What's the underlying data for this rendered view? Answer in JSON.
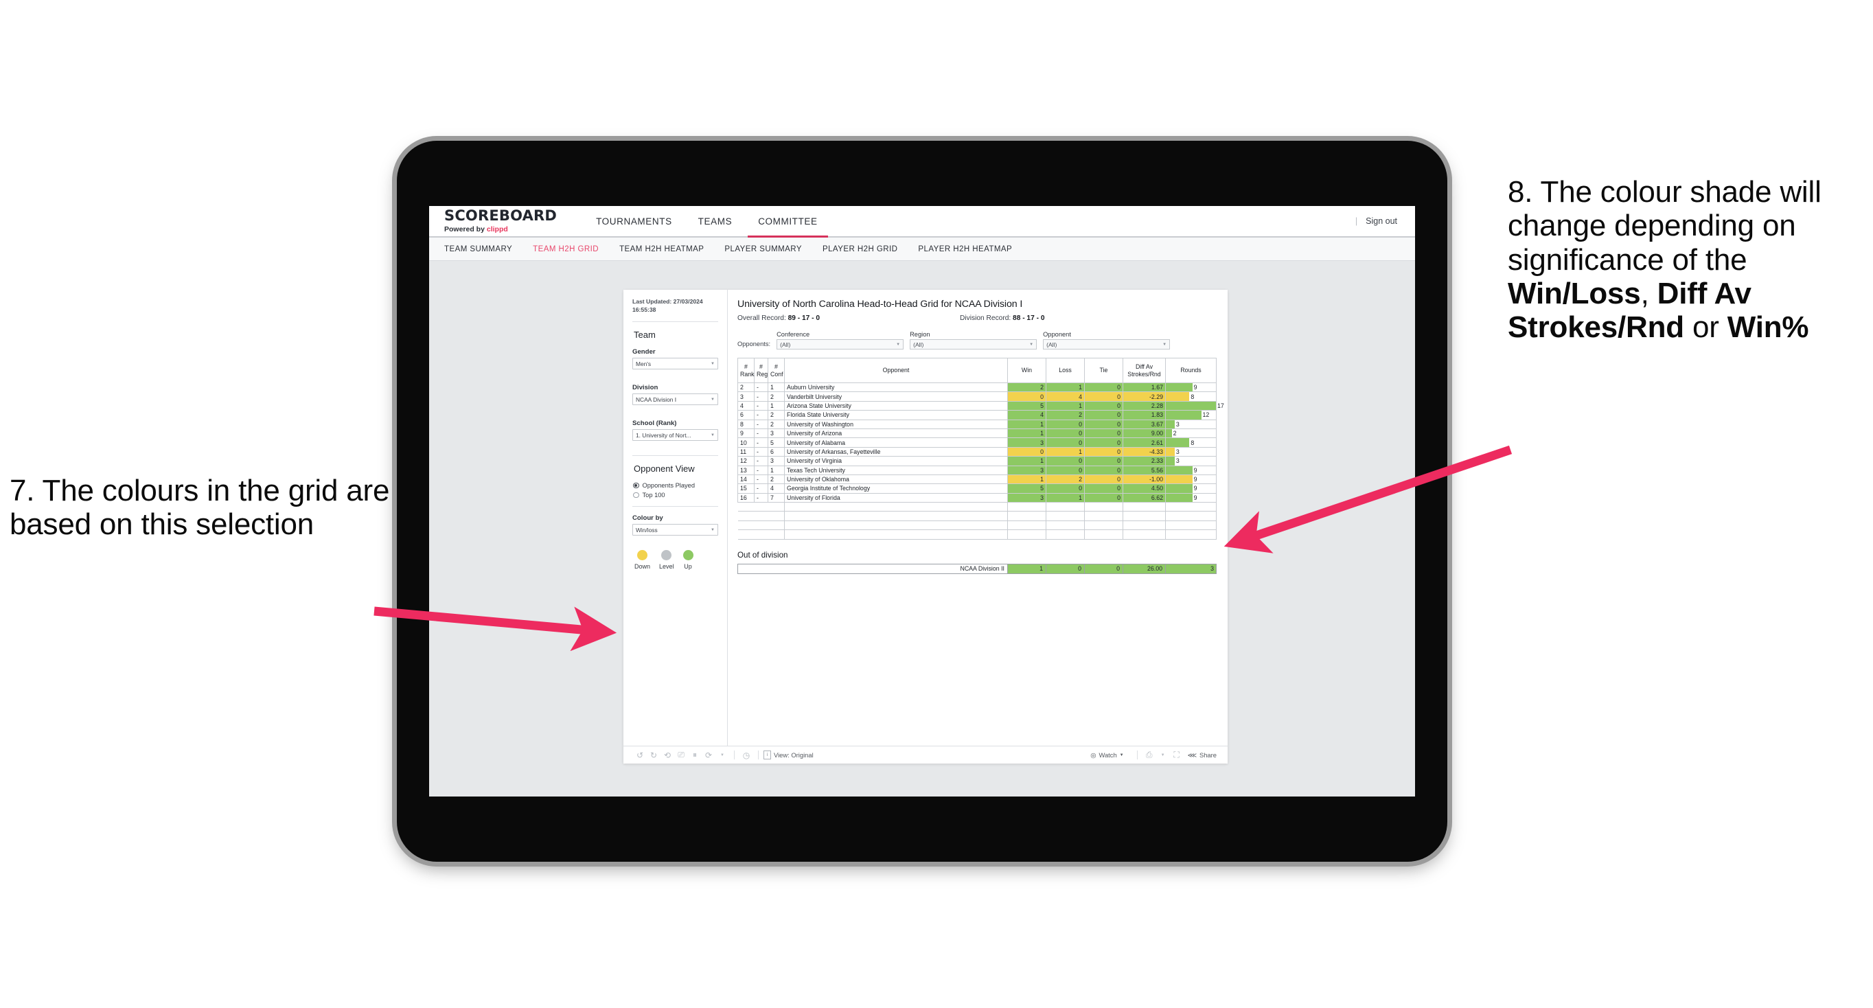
{
  "annotations": {
    "left": "7. The colours in the grid are based on this selection",
    "right_plain_1": "8. The colour shade will change depending on significance of the ",
    "right_bold_1": "Win/Loss",
    "right_plain_2": ", ",
    "right_bold_2": "Diff Av Strokes/Rnd",
    "right_plain_3": " or ",
    "right_bold_3": "Win%",
    "arrow_color": "#ED2B5F"
  },
  "app": {
    "brand_title": "SCOREBOARD",
    "brand_sub_prefix": "Powered by ",
    "brand_sub_accent": "clippd",
    "nav": [
      {
        "label": "TOURNAMENTS",
        "active": false
      },
      {
        "label": "TEAMS",
        "active": false
      },
      {
        "label": "COMMITTEE",
        "active": true
      }
    ],
    "divider": "|",
    "sign_out": "Sign out",
    "subnav": [
      {
        "label": "TEAM SUMMARY",
        "active": false
      },
      {
        "label": "TEAM H2H GRID",
        "active": true
      },
      {
        "label": "TEAM H2H HEATMAP",
        "active": false
      },
      {
        "label": "PLAYER SUMMARY",
        "active": false
      },
      {
        "label": "PLAYER H2H GRID",
        "active": false
      },
      {
        "label": "PLAYER H2H HEATMAP",
        "active": false
      }
    ],
    "accent_color": "#E8486C"
  },
  "sidebar": {
    "last_updated": "Last Updated: 27/03/2024 16:55:38",
    "team_title": "Team",
    "gender_label": "Gender",
    "gender_value": "Men's",
    "division_label": "Division",
    "division_value": "NCAA Division I",
    "school_label": "School (Rank)",
    "school_value": "1. University of Nort...",
    "opponent_view_title": "Opponent View",
    "radio_opponents_played": "Opponents Played",
    "radio_top_100": "Top 100",
    "colour_by_label": "Colour by",
    "colour_by_value": "Win/loss",
    "legend": [
      {
        "label": "Down",
        "color": "#F2D24D"
      },
      {
        "label": "Level",
        "color": "#BFC3C7"
      },
      {
        "label": "Up",
        "color": "#8DC963"
      }
    ]
  },
  "main": {
    "title": "University of North Carolina Head-to-Head Grid for NCAA Division I",
    "overall_record_label": "Overall Record: ",
    "overall_record_value": "89 - 17 - 0",
    "division_record_label": "Division Record: ",
    "division_record_value": "88 - 17 - 0",
    "opponents_label": "Opponents:",
    "filters": [
      {
        "caption": "Conference",
        "value": "(All)"
      },
      {
        "caption": "Region",
        "value": "(All)"
      },
      {
        "caption": "Opponent",
        "value": "(All)"
      }
    ],
    "headers": [
      "# Rank",
      "# Reg",
      "# Conf",
      "Opponent",
      "Win",
      "Loss",
      "Tie",
      "Diff Av Strokes/Rnd",
      "Rounds"
    ],
    "out_of_division_title": "Out of division",
    "out_of_division_row": {
      "name": "NCAA Division II",
      "win": "1",
      "loss": "0",
      "tie": "0",
      "diff": "26.00",
      "rounds": "3",
      "color": "#8DC963",
      "bar_pct": 100
    }
  },
  "chart_data": {
    "type": "table",
    "title": "University of North Carolina Head-to-Head Grid for NCAA Division I",
    "columns": [
      "# Rank",
      "# Reg",
      "# Conf",
      "Opponent",
      "Win",
      "Loss",
      "Tie",
      "Diff Av Strokes/Rnd",
      "Rounds"
    ],
    "colour_by": "Win/loss",
    "colour_scale": {
      "Down": "#F2D24D",
      "Level": "#BFC3C7",
      "Up": "#8DC963"
    },
    "rounds_max": 17,
    "rows": [
      {
        "rank": "2",
        "reg": "-",
        "conf": "1",
        "opponent": "Auburn University",
        "win": "2",
        "loss": "1",
        "tie": "0",
        "diff": "1.67",
        "rounds": "9",
        "color": "#8DC963"
      },
      {
        "rank": "3",
        "reg": "-",
        "conf": "2",
        "opponent": "Vanderbilt University",
        "win": "0",
        "loss": "4",
        "tie": "0",
        "diff": "-2.29",
        "rounds": "8",
        "color": "#F2D24D"
      },
      {
        "rank": "4",
        "reg": "-",
        "conf": "1",
        "opponent": "Arizona State University",
        "win": "5",
        "loss": "1",
        "tie": "0",
        "diff": "2.28",
        "rounds": "17",
        "color": "#8DC963"
      },
      {
        "rank": "6",
        "reg": "-",
        "conf": "2",
        "opponent": "Florida State University",
        "win": "4",
        "loss": "2",
        "tie": "0",
        "diff": "1.83",
        "rounds": "12",
        "color": "#8DC963"
      },
      {
        "rank": "8",
        "reg": "-",
        "conf": "2",
        "opponent": "University of Washington",
        "win": "1",
        "loss": "0",
        "tie": "0",
        "diff": "3.67",
        "rounds": "3",
        "color": "#8DC963"
      },
      {
        "rank": "9",
        "reg": "-",
        "conf": "3",
        "opponent": "University of Arizona",
        "win": "1",
        "loss": "0",
        "tie": "0",
        "diff": "9.00",
        "rounds": "2",
        "color": "#8DC963"
      },
      {
        "rank": "10",
        "reg": "-",
        "conf": "5",
        "opponent": "University of Alabama",
        "win": "3",
        "loss": "0",
        "tie": "0",
        "diff": "2.61",
        "rounds": "8",
        "color": "#8DC963"
      },
      {
        "rank": "11",
        "reg": "-",
        "conf": "6",
        "opponent": "University of Arkansas, Fayetteville",
        "win": "0",
        "loss": "1",
        "tie": "0",
        "diff": "-4.33",
        "rounds": "3",
        "color": "#F2D24D"
      },
      {
        "rank": "12",
        "reg": "-",
        "conf": "3",
        "opponent": "University of Virginia",
        "win": "1",
        "loss": "0",
        "tie": "0",
        "diff": "2.33",
        "rounds": "3",
        "color": "#8DC963"
      },
      {
        "rank": "13",
        "reg": "-",
        "conf": "1",
        "opponent": "Texas Tech University",
        "win": "3",
        "loss": "0",
        "tie": "0",
        "diff": "5.56",
        "rounds": "9",
        "color": "#8DC963"
      },
      {
        "rank": "14",
        "reg": "-",
        "conf": "2",
        "opponent": "University of Oklahoma",
        "win": "1",
        "loss": "2",
        "tie": "0",
        "diff": "-1.00",
        "rounds": "9",
        "color": "#F2D24D"
      },
      {
        "rank": "15",
        "reg": "-",
        "conf": "4",
        "opponent": "Georgia Institute of Technology",
        "win": "5",
        "loss": "0",
        "tie": "0",
        "diff": "4.50",
        "rounds": "9",
        "color": "#8DC963"
      },
      {
        "rank": "16",
        "reg": "-",
        "conf": "7",
        "opponent": "University of Florida",
        "win": "3",
        "loss": "1",
        "tie": "0",
        "diff": "6.62",
        "rounds": "9",
        "color": "#8DC963"
      }
    ]
  },
  "toolbar": {
    "view_label": "View: Original",
    "watch_label": "Watch",
    "share_label": "Share"
  }
}
